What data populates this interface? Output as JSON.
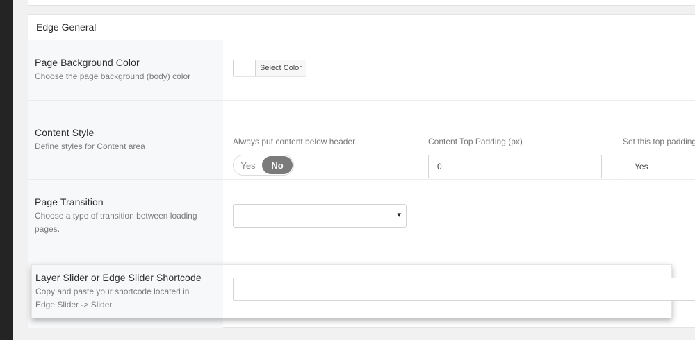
{
  "panel": {
    "title": "Edge General"
  },
  "rows": {
    "page_background": {
      "title": "Page Background Color",
      "desc": "Choose the page background (body) color",
      "button_label": "Select Color"
    },
    "content_style": {
      "title": "Content Style",
      "desc": "Define styles for Content area",
      "below_header_label": "Always put content below header",
      "toggle_yes": "Yes",
      "toggle_no": "No",
      "toggle_value": "No",
      "top_padding_label": "Content Top Padding (px)",
      "top_padding_value": "0",
      "set_top_padding_label": "Set this top padding",
      "set_top_padding_value": "Yes"
    },
    "page_transition": {
      "title": "Page Transition",
      "desc_line1": "Choose a type of transition between loading",
      "desc_line2": "pages.",
      "selected_value": ""
    },
    "slider_shortcode": {
      "title": "Layer Slider or Edge Slider Shortcode",
      "desc_line1": "Copy and paste your shortcode located in",
      "desc_line2": "Edge Slider -> Slider",
      "value": ""
    }
  },
  "icons": {
    "select_arrow": "▾"
  },
  "colors": {
    "left_sidebar": "#242424",
    "toggle_active": "#7b7b7b",
    "label_column_bg": "#f7f8fa"
  }
}
